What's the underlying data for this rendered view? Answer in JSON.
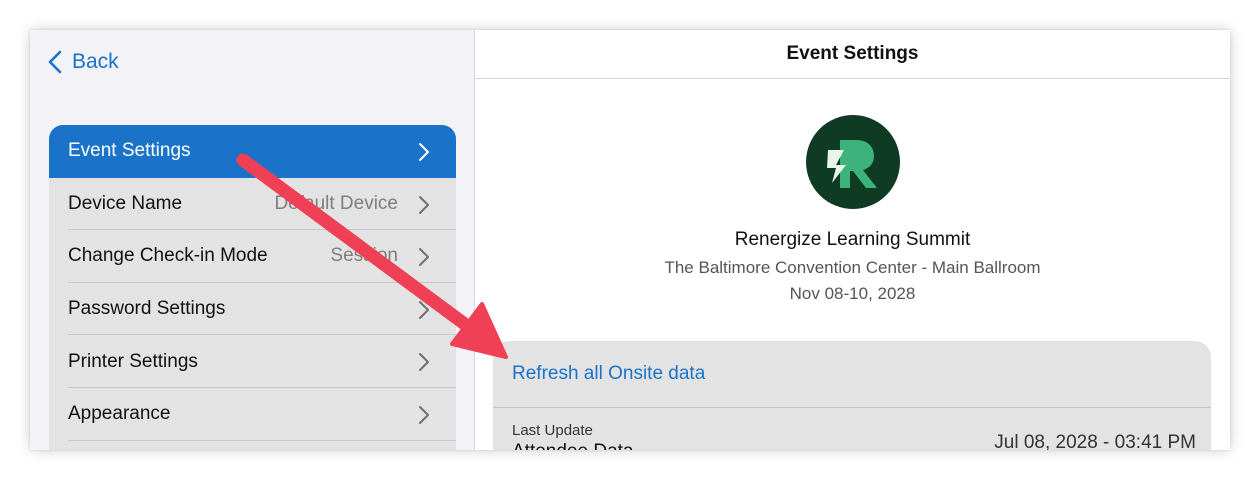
{
  "sidebar": {
    "back_label": "Back",
    "items": [
      {
        "label": "Event Settings",
        "value": ""
      },
      {
        "label": "Device Name",
        "value": "Default Device"
      },
      {
        "label": "Change Check-in Mode",
        "value": "Session"
      },
      {
        "label": "Password Settings",
        "value": ""
      },
      {
        "label": "Printer Settings",
        "value": ""
      },
      {
        "label": "Appearance",
        "value": ""
      }
    ]
  },
  "header": {
    "title": "Event Settings"
  },
  "event": {
    "name": "Renergize Learning Summit",
    "venue": "The Baltimore Convention Center - Main Ballroom",
    "dates": "Nov 08-10, 2028"
  },
  "card": {
    "refresh_label": "Refresh all Onsite data",
    "last_update_label": "Last Update",
    "last_update_sub": "Attendee Data",
    "last_update_value": "Jul 08, 2028 - 03:41 PM"
  },
  "colors": {
    "accent": "#1a73c9",
    "annotation_arrow": "#ef4056",
    "logo_bg": "#0f3b24"
  }
}
